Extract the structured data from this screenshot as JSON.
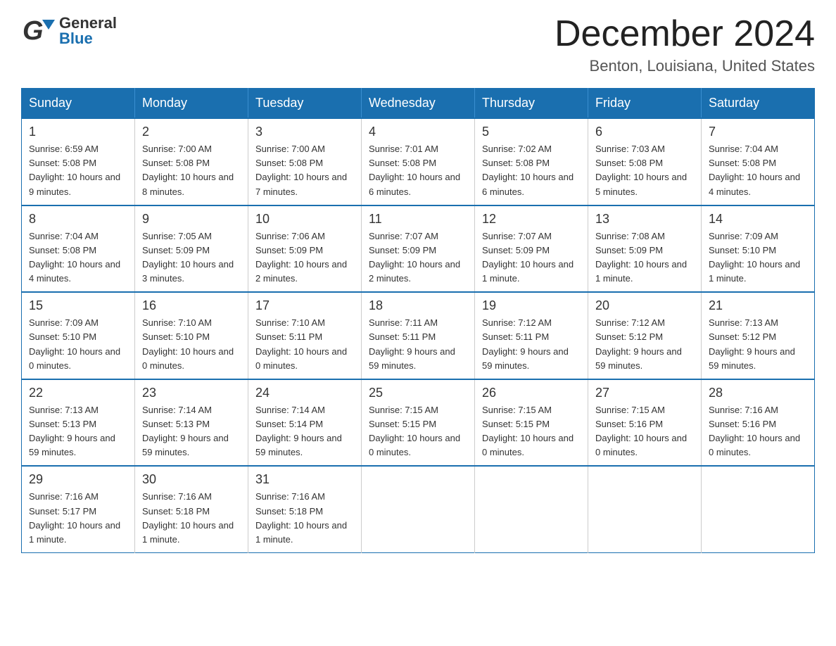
{
  "header": {
    "month_title": "December 2024",
    "location": "Benton, Louisiana, United States",
    "logo_text_general": "General",
    "logo_text_blue": "Blue"
  },
  "days_of_week": [
    "Sunday",
    "Monday",
    "Tuesday",
    "Wednesday",
    "Thursday",
    "Friday",
    "Saturday"
  ],
  "weeks": [
    [
      {
        "day": "1",
        "sunrise": "6:59 AM",
        "sunset": "5:08 PM",
        "daylight": "10 hours and 9 minutes."
      },
      {
        "day": "2",
        "sunrise": "7:00 AM",
        "sunset": "5:08 PM",
        "daylight": "10 hours and 8 minutes."
      },
      {
        "day": "3",
        "sunrise": "7:00 AM",
        "sunset": "5:08 PM",
        "daylight": "10 hours and 7 minutes."
      },
      {
        "day": "4",
        "sunrise": "7:01 AM",
        "sunset": "5:08 PM",
        "daylight": "10 hours and 6 minutes."
      },
      {
        "day": "5",
        "sunrise": "7:02 AM",
        "sunset": "5:08 PM",
        "daylight": "10 hours and 6 minutes."
      },
      {
        "day": "6",
        "sunrise": "7:03 AM",
        "sunset": "5:08 PM",
        "daylight": "10 hours and 5 minutes."
      },
      {
        "day": "7",
        "sunrise": "7:04 AM",
        "sunset": "5:08 PM",
        "daylight": "10 hours and 4 minutes."
      }
    ],
    [
      {
        "day": "8",
        "sunrise": "7:04 AM",
        "sunset": "5:08 PM",
        "daylight": "10 hours and 4 minutes."
      },
      {
        "day": "9",
        "sunrise": "7:05 AM",
        "sunset": "5:09 PM",
        "daylight": "10 hours and 3 minutes."
      },
      {
        "day": "10",
        "sunrise": "7:06 AM",
        "sunset": "5:09 PM",
        "daylight": "10 hours and 2 minutes."
      },
      {
        "day": "11",
        "sunrise": "7:07 AM",
        "sunset": "5:09 PM",
        "daylight": "10 hours and 2 minutes."
      },
      {
        "day": "12",
        "sunrise": "7:07 AM",
        "sunset": "5:09 PM",
        "daylight": "10 hours and 1 minute."
      },
      {
        "day": "13",
        "sunrise": "7:08 AM",
        "sunset": "5:09 PM",
        "daylight": "10 hours and 1 minute."
      },
      {
        "day": "14",
        "sunrise": "7:09 AM",
        "sunset": "5:10 PM",
        "daylight": "10 hours and 1 minute."
      }
    ],
    [
      {
        "day": "15",
        "sunrise": "7:09 AM",
        "sunset": "5:10 PM",
        "daylight": "10 hours and 0 minutes."
      },
      {
        "day": "16",
        "sunrise": "7:10 AM",
        "sunset": "5:10 PM",
        "daylight": "10 hours and 0 minutes."
      },
      {
        "day": "17",
        "sunrise": "7:10 AM",
        "sunset": "5:11 PM",
        "daylight": "10 hours and 0 minutes."
      },
      {
        "day": "18",
        "sunrise": "7:11 AM",
        "sunset": "5:11 PM",
        "daylight": "9 hours and 59 minutes."
      },
      {
        "day": "19",
        "sunrise": "7:12 AM",
        "sunset": "5:11 PM",
        "daylight": "9 hours and 59 minutes."
      },
      {
        "day": "20",
        "sunrise": "7:12 AM",
        "sunset": "5:12 PM",
        "daylight": "9 hours and 59 minutes."
      },
      {
        "day": "21",
        "sunrise": "7:13 AM",
        "sunset": "5:12 PM",
        "daylight": "9 hours and 59 minutes."
      }
    ],
    [
      {
        "day": "22",
        "sunrise": "7:13 AM",
        "sunset": "5:13 PM",
        "daylight": "9 hours and 59 minutes."
      },
      {
        "day": "23",
        "sunrise": "7:14 AM",
        "sunset": "5:13 PM",
        "daylight": "9 hours and 59 minutes."
      },
      {
        "day": "24",
        "sunrise": "7:14 AM",
        "sunset": "5:14 PM",
        "daylight": "9 hours and 59 minutes."
      },
      {
        "day": "25",
        "sunrise": "7:15 AM",
        "sunset": "5:15 PM",
        "daylight": "10 hours and 0 minutes."
      },
      {
        "day": "26",
        "sunrise": "7:15 AM",
        "sunset": "5:15 PM",
        "daylight": "10 hours and 0 minutes."
      },
      {
        "day": "27",
        "sunrise": "7:15 AM",
        "sunset": "5:16 PM",
        "daylight": "10 hours and 0 minutes."
      },
      {
        "day": "28",
        "sunrise": "7:16 AM",
        "sunset": "5:16 PM",
        "daylight": "10 hours and 0 minutes."
      }
    ],
    [
      {
        "day": "29",
        "sunrise": "7:16 AM",
        "sunset": "5:17 PM",
        "daylight": "10 hours and 1 minute."
      },
      {
        "day": "30",
        "sunrise": "7:16 AM",
        "sunset": "5:18 PM",
        "daylight": "10 hours and 1 minute."
      },
      {
        "day": "31",
        "sunrise": "7:16 AM",
        "sunset": "5:18 PM",
        "daylight": "10 hours and 1 minute."
      },
      {
        "day": "",
        "sunrise": "",
        "sunset": "",
        "daylight": ""
      },
      {
        "day": "",
        "sunrise": "",
        "sunset": "",
        "daylight": ""
      },
      {
        "day": "",
        "sunrise": "",
        "sunset": "",
        "daylight": ""
      },
      {
        "day": "",
        "sunrise": "",
        "sunset": "",
        "daylight": ""
      }
    ]
  ]
}
